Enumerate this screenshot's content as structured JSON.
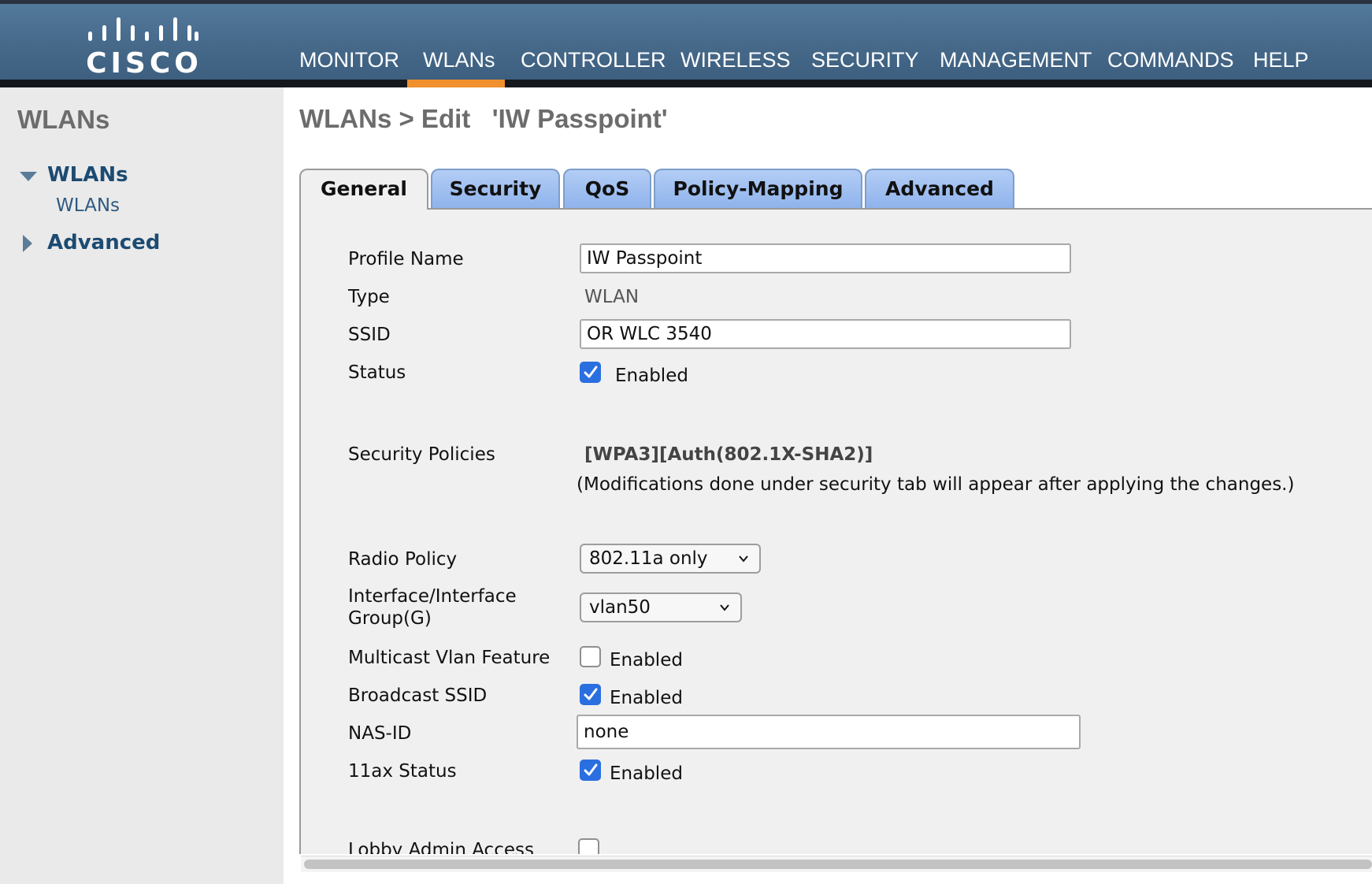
{
  "brand": {
    "logo_text": "CISCO"
  },
  "nav": {
    "items": [
      {
        "label": "MONITOR"
      },
      {
        "label": "WLANs"
      },
      {
        "label": "CONTROLLER"
      },
      {
        "label": "WIRELESS"
      },
      {
        "label": "SECURITY"
      },
      {
        "label": "MANAGEMENT"
      },
      {
        "label": "COMMANDS"
      },
      {
        "label": "HELP"
      }
    ],
    "active": "WLANs"
  },
  "sidebar": {
    "title": "WLANs",
    "groups": [
      {
        "label": "WLANs",
        "expanded": true,
        "children": [
          {
            "label": "WLANs"
          }
        ]
      },
      {
        "label": "Advanced",
        "expanded": false
      }
    ]
  },
  "page": {
    "title": "WLANs > Edit   'IW Passpoint'"
  },
  "tabs": [
    {
      "label": "General",
      "active": true
    },
    {
      "label": "Security"
    },
    {
      "label": "QoS"
    },
    {
      "label": "Policy-Mapping"
    },
    {
      "label": "Advanced"
    }
  ],
  "form": {
    "profile_name": {
      "label": "Profile Name",
      "value": "IW Passpoint"
    },
    "type": {
      "label": "Type",
      "value": "WLAN"
    },
    "ssid": {
      "label": "SSID",
      "value": "OR WLC 3540"
    },
    "status": {
      "label": "Status",
      "checked": true,
      "text": "Enabled"
    },
    "security_policies": {
      "label": "Security Policies",
      "value": "[WPA3][Auth(802.1X-SHA2)]",
      "note": "(Modifications done under security tab will appear after applying the changes.)"
    },
    "radio_policy": {
      "label": "Radio Policy",
      "value": "802.11a only"
    },
    "interface_group": {
      "label_line1": "Interface/Interface",
      "label_line2": "Group(G)",
      "value": "vlan50"
    },
    "multicast_vlan": {
      "label": "Multicast Vlan Feature",
      "checked": false,
      "text": "Enabled"
    },
    "broadcast_ssid": {
      "label": "Broadcast SSID",
      "checked": true,
      "text": "Enabled"
    },
    "nas_id": {
      "label": "NAS-ID",
      "value": "none"
    },
    "ax_status": {
      "label": "11ax Status",
      "checked": true,
      "text": "Enabled"
    },
    "lobby_admin": {
      "label": "Lobby Admin Access",
      "checked": false
    }
  },
  "colors": {
    "header": "#4a6e90",
    "active_nav": "#f0902e",
    "tab": "#9dbdf0",
    "checkbox": "#2a6fe0",
    "sidebar_link": "#1d4b72"
  }
}
